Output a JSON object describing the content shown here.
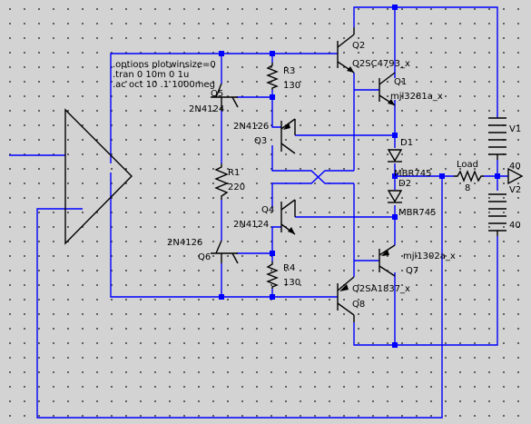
{
  "directives": [
    ".options plotwinsize=0",
    ".tran 0 10m 0 1u",
    ".ac oct 10 .1 1000meg"
  ],
  "components": {
    "q2": {
      "ref": "Q2",
      "model": "Q2SC4793_x"
    },
    "q1": {
      "ref": "Q1",
      "model": "mjl3281a_x"
    },
    "q5": {
      "ref": "Q5",
      "model": "2N4124"
    },
    "q3": {
      "ref": "Q3",
      "model": "2N4126"
    },
    "q4": {
      "ref": "Q4",
      "model": "2N4124"
    },
    "q6": {
      "ref": "Q6",
      "model": "2N4126"
    },
    "q7": {
      "ref": "Q7",
      "model": "mjl1302a_x"
    },
    "q8": {
      "ref": "Q8",
      "model": "Q2SA1837_x"
    },
    "r3": {
      "ref": "R3",
      "value": "130"
    },
    "r1": {
      "ref": "R1",
      "value": "220"
    },
    "r4": {
      "ref": "R4",
      "value": "130"
    },
    "load": {
      "ref": "Load",
      "value": "8"
    },
    "d1": {
      "ref": "D1",
      "model": "MBR745"
    },
    "d2": {
      "ref": "D2",
      "model": "MBR745"
    },
    "v1": {
      "ref": "V1",
      "value": "40"
    },
    "v2": {
      "ref": "V2",
      "value": "40"
    }
  },
  "colors": {
    "wire": "#0000ff",
    "component": "#000000",
    "background": "#d3d3d3",
    "grid_dot": "#4a4a4a"
  }
}
